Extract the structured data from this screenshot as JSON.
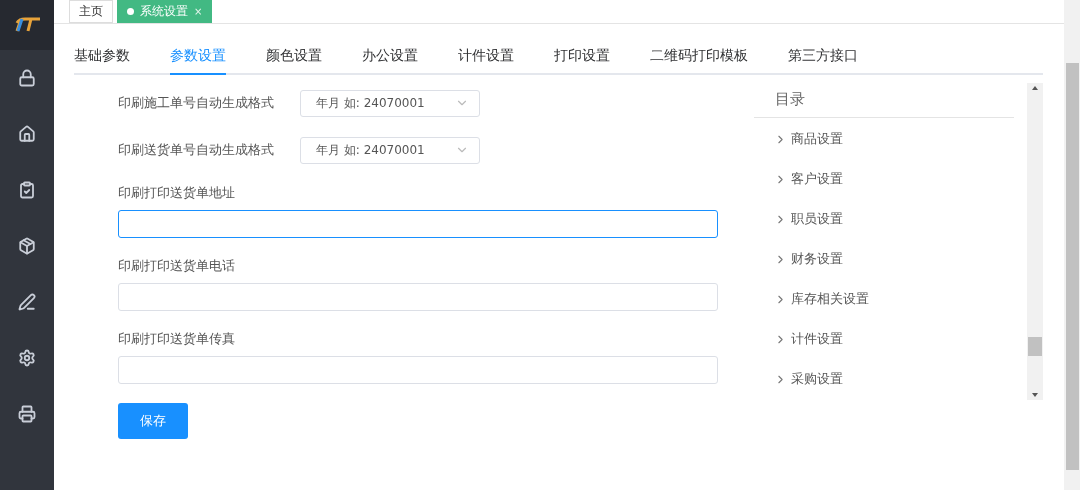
{
  "page_tabs": [
    {
      "label": "主页",
      "selected": false
    },
    {
      "label": "系统设置",
      "selected": true,
      "close": "×"
    }
  ],
  "settings_tabs": [
    {
      "label": "基础参数",
      "selected": false
    },
    {
      "label": "参数设置",
      "selected": true
    },
    {
      "label": "颜色设置",
      "selected": false
    },
    {
      "label": "办公设置",
      "selected": false
    },
    {
      "label": "计件设置",
      "selected": false
    },
    {
      "label": "打印设置",
      "selected": false
    },
    {
      "label": "二维码打印模板",
      "selected": false
    },
    {
      "label": "第三方接口",
      "selected": false
    }
  ],
  "form": [
    {
      "kind": "select",
      "label": "印刷施工单号自动生成格式",
      "value": "年月 如: 24070001"
    },
    {
      "kind": "select",
      "label": "印刷送货单号自动生成格式",
      "value": "年月 如: 24070001"
    },
    {
      "kind": "text",
      "label": "印刷打印送货单地址",
      "focused": true
    },
    {
      "kind": "text",
      "label": "印刷打印送货单电话",
      "focused": false
    },
    {
      "kind": "text",
      "label": "印刷打印送货单传真",
      "focused": false
    }
  ],
  "save_button": "保存",
  "toc": {
    "title": "目录",
    "items": [
      "商品设置",
      "客户设置",
      "职员设置",
      "财务设置",
      "库存相关设置",
      "计件设置",
      "采购设置"
    ]
  }
}
